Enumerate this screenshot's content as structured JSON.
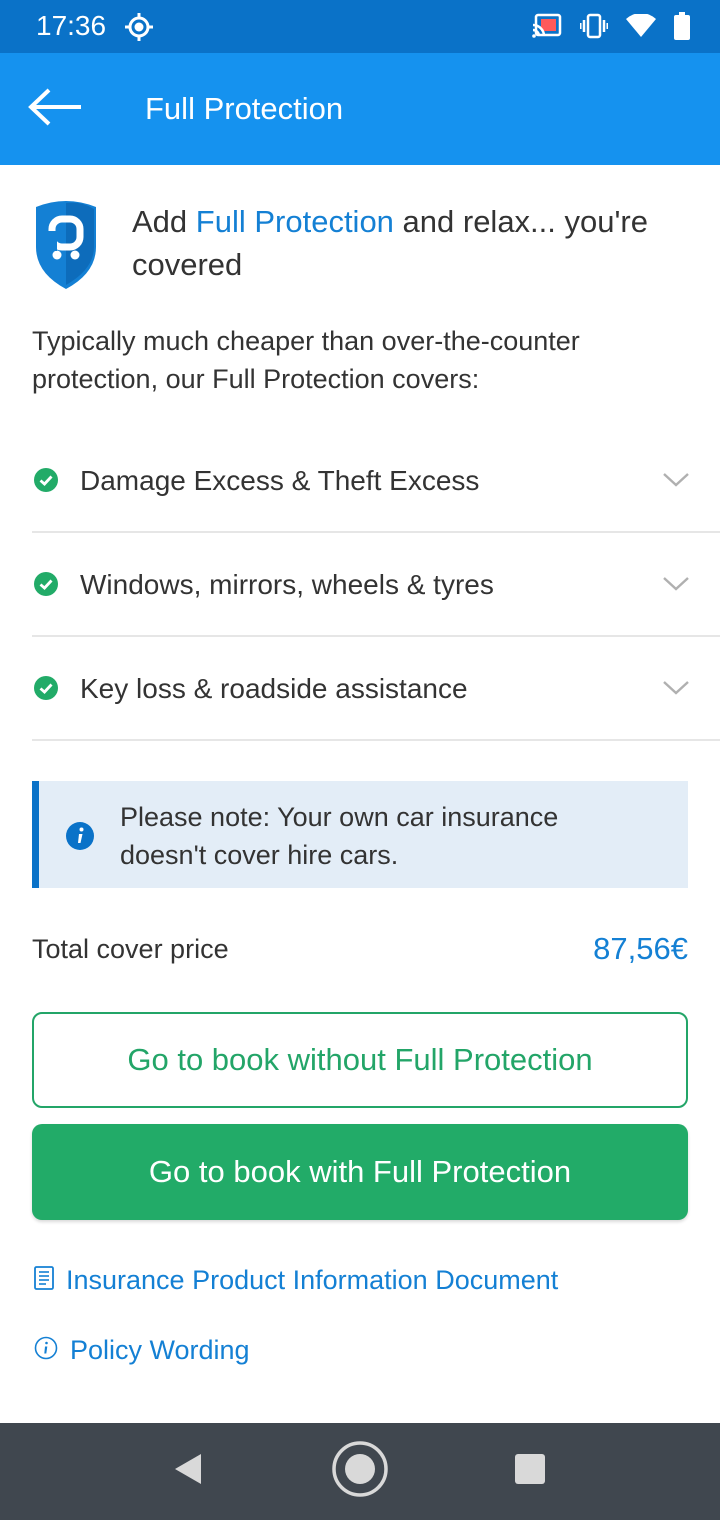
{
  "status_bar": {
    "time": "17:36",
    "icons": [
      "location-icon",
      "cast-icon",
      "vibrate-icon",
      "wifi-icon",
      "battery-icon"
    ]
  },
  "app_bar": {
    "back_icon": "arrow-left-icon",
    "title": "Full Protection"
  },
  "hero": {
    "logo_icon": "shield-logo-icon",
    "text_prefix": "Add ",
    "text_accent": "Full Protection",
    "text_suffix": " and relax... you're covered"
  },
  "intro": "Typically much cheaper than over-the-counter protection, our Full Protection covers:",
  "cover_items": [
    {
      "label": "Damage Excess & Theft Excess",
      "icon": "check-circle-icon"
    },
    {
      "label": "Windows, mirrors, wheels & tyres",
      "icon": "check-circle-icon"
    },
    {
      "label": "Key loss & roadside assistance",
      "icon": "check-circle-icon"
    }
  ],
  "note": {
    "icon": "info-icon",
    "text": "Please note: Your own car insurance doesn't cover hire cars."
  },
  "price": {
    "label": "Total cover price",
    "value": "87,56€"
  },
  "buttons": {
    "without": "Go to book without Full Protection",
    "with": "Go to book with Full Protection"
  },
  "links": {
    "ipid": "Insurance Product Information Document",
    "policy": "Policy Wording"
  },
  "colors": {
    "status_bar": "#0a72c8",
    "app_bar": "#1592ef",
    "accent_blue": "#1480d4",
    "green": "#22ab68",
    "note_bg": "#e3edf7",
    "nav_bar": "#40474f"
  }
}
